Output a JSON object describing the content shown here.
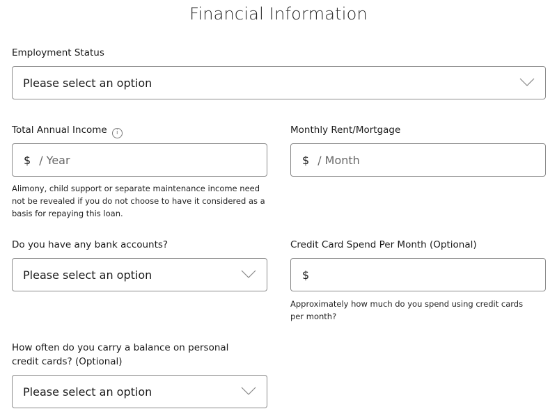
{
  "page": {
    "title": "Financial Information"
  },
  "employment_status": {
    "label": "Employment Status",
    "value": "Please select an option"
  },
  "annual_income": {
    "label": "Total Annual Income",
    "info_icon": "i",
    "currency": "$",
    "placeholder": "/ Year",
    "help": "Alimony, child support or separate maintenance income need not be revealed if you do not choose to have it considered as a basis for repaying this loan."
  },
  "rent_mortgage": {
    "label": "Monthly Rent/Mortgage",
    "currency": "$",
    "placeholder": "/ Month"
  },
  "bank_accounts": {
    "label": "Do you have any bank accounts?",
    "value": "Please select an option"
  },
  "credit_card_spend": {
    "label": "Credit Card Spend Per Month (Optional)",
    "currency": "$",
    "help": "Approximately how much do you spend using credit cards per month?"
  },
  "carry_balance": {
    "label": "How often do you carry a balance on personal credit cards? (Optional)",
    "value": "Please select an option"
  }
}
